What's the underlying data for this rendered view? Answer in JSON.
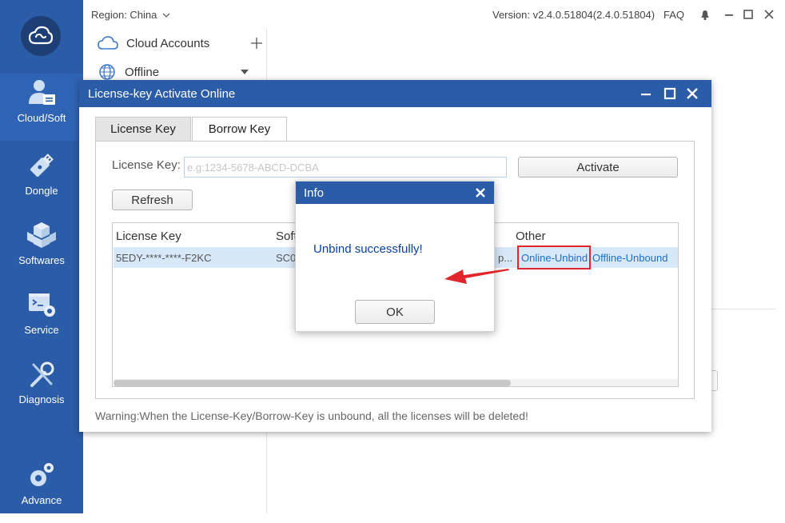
{
  "sidebar": {
    "items": [
      {
        "label": "Cloud/Soft",
        "icon": "user-card-icon",
        "active": true
      },
      {
        "label": "Dongle",
        "icon": "usb-dongle-icon"
      },
      {
        "label": "Softwares",
        "icon": "cubes-icon"
      },
      {
        "label": "Service",
        "icon": "terminal-gear-icon"
      },
      {
        "label": "Diagnosis",
        "icon": "wrench-screwdriver-icon"
      },
      {
        "label": "Advance",
        "icon": "gears-icon"
      }
    ]
  },
  "topbar": {
    "region": "Region: China",
    "version": "Version: v2.4.0.51804(2.4.0.51804)",
    "faq": "FAQ"
  },
  "background": {
    "cloud_accounts": "Cloud Accounts",
    "offline": "Offline"
  },
  "license_dialog": {
    "title": "License-key Activate Online",
    "tabs": [
      "License Key",
      "Borrow Key"
    ],
    "license_key_label": "License Key:",
    "license_key_placeholder": "e.g:1234-5678-ABCD-DCBA",
    "activate_label": "Activate",
    "refresh_label": "Refresh",
    "table": {
      "headers": [
        "License Key",
        "Soft",
        "Other"
      ],
      "rows": [
        {
          "license_key": "5EDY-****-****-F2KC",
          "soft": "SC0",
          "truncated": "p...",
          "online_unbind": "Online-Unbind",
          "offline_unbound": "Offline-Unbound"
        }
      ]
    },
    "warning": "Warning:When the License-Key/Borrow-Key is unbound, all the licenses will be deleted!"
  },
  "info_dialog": {
    "title": "Info",
    "message": "Unbind successfully!",
    "ok_label": "OK"
  },
  "colors": {
    "brand_blue": "#2b5ca8",
    "highlight_red": "#e0262a",
    "link_blue": "#1a6fcf",
    "row_selected": "#d7e8f8"
  }
}
